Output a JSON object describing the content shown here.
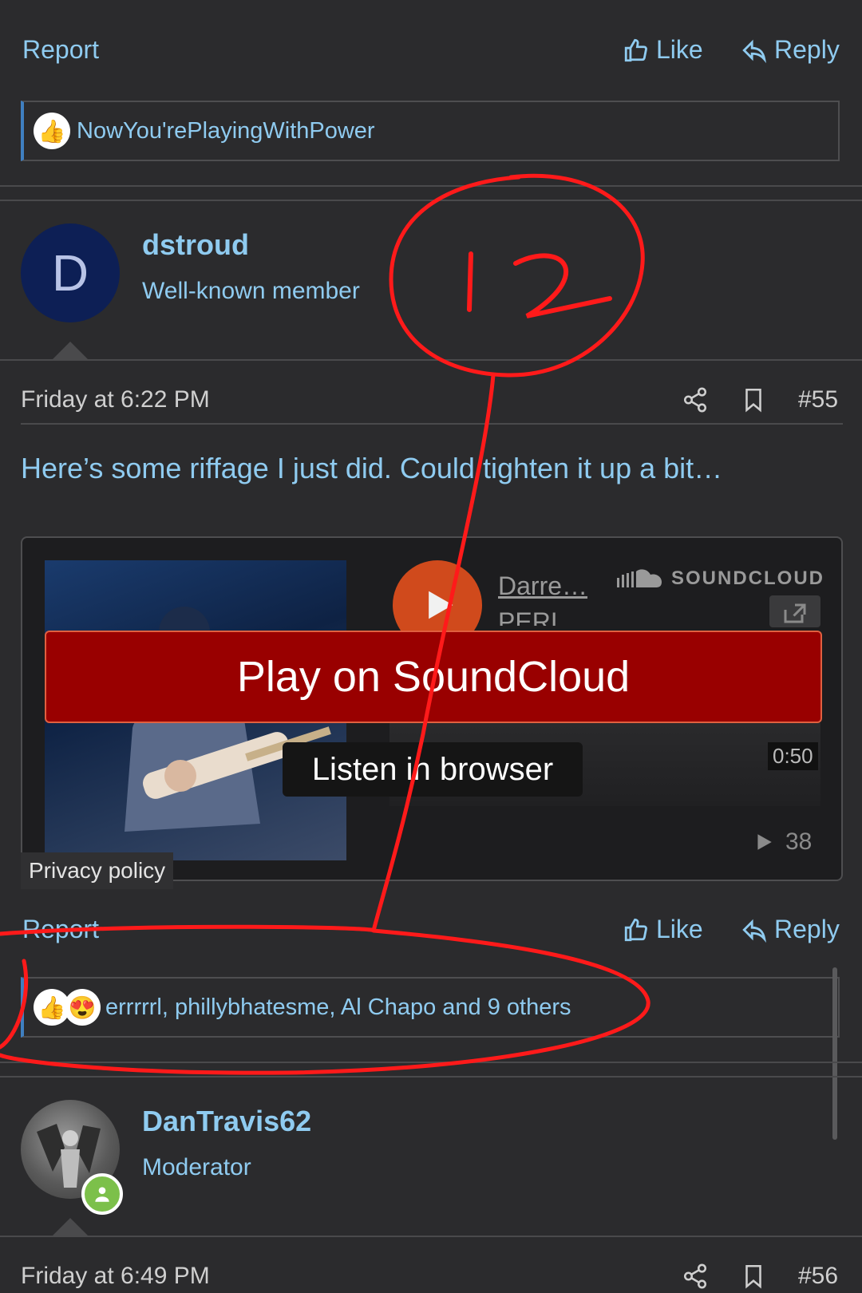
{
  "top_actions": {
    "report": "Report",
    "like": "Like",
    "reply": "Reply"
  },
  "top_reactions": {
    "text": "NowYou'rePlayingWithPower",
    "emojis": [
      "👍"
    ]
  },
  "annotation": {
    "text": "12",
    "color": "#ff1a1a"
  },
  "post55": {
    "author": "dstroud",
    "role": "Well-known member",
    "avatar_letter": "D",
    "date": "Friday at 6:22 PM",
    "number": "#55",
    "body": "Here’s some riffage I just did. Could tighten it up a bit…",
    "embed": {
      "artist": "Darre…",
      "track": "PERI",
      "brand": "SOUNDCLOUD",
      "cta": "Play on SoundCloud",
      "listen": "Listen in browser",
      "duration": "0:50",
      "plays": "38",
      "privacy": "Privacy policy"
    },
    "actions": {
      "report": "Report",
      "like": "Like",
      "reply": "Reply"
    },
    "reactions": {
      "text": "errrrrl, phillybhatesme, Al Chapo and 9 others",
      "emojis": [
        "👍",
        "😍"
      ]
    }
  },
  "post56": {
    "author": "DanTravis62",
    "role": "Moderator",
    "date": "Friday at 6:49 PM",
    "number": "#56"
  },
  "colors": {
    "background": "#2b2b2d",
    "link": "#8fcbf0",
    "cta": "#990000",
    "accent_border": "#3f7fc1"
  }
}
